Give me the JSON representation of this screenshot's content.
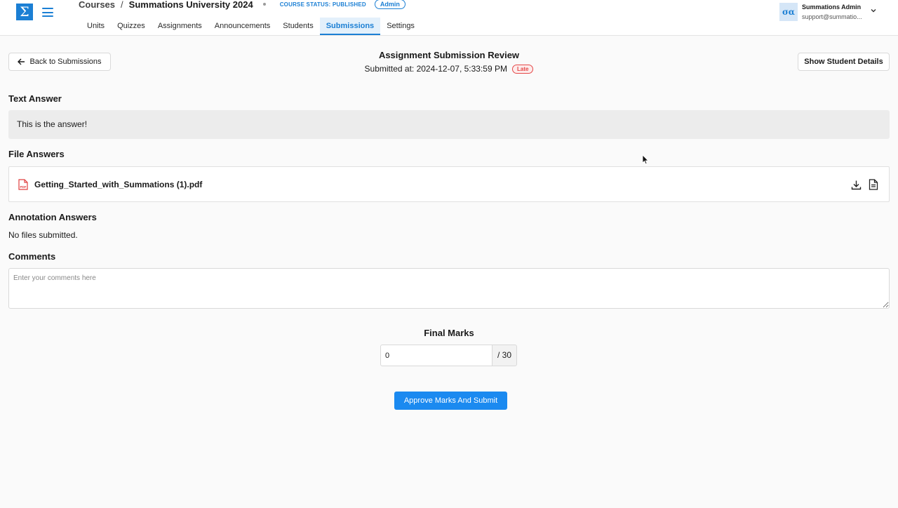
{
  "header": {
    "logo_glyph": "Σ",
    "breadcrumb": {
      "courses": "Courses",
      "separator": "/",
      "course_name": "Summations University 2024",
      "status": "COURSE STATUS: PUBLISHED",
      "role_badge": "Admin"
    },
    "tabs": [
      {
        "label": "Units",
        "active": false
      },
      {
        "label": "Quizzes",
        "active": false
      },
      {
        "label": "Assignments",
        "active": false
      },
      {
        "label": "Announcements",
        "active": false
      },
      {
        "label": "Students",
        "active": false
      },
      {
        "label": "Submissions",
        "active": true
      },
      {
        "label": "Settings",
        "active": false
      }
    ],
    "user": {
      "avatar_text": "σα",
      "name": "Summations Admin",
      "email": "support@summatio..."
    }
  },
  "review": {
    "back_label": "Back to Submissions",
    "title": "Assignment Submission Review",
    "submitted_at": "Submitted at: 2024-12-07, 5:33:59 PM",
    "late_badge": "Late",
    "show_details_label": "Show Student Details"
  },
  "text_answer": {
    "heading": "Text Answer",
    "content": "This is the answer!"
  },
  "file_answers": {
    "heading": "File Answers",
    "files": [
      {
        "name": "Getting_Started_with_Summations (1).pdf",
        "icon": "pdf-icon"
      }
    ]
  },
  "annotation_answers": {
    "heading": "Annotation Answers",
    "empty_text": "No files submitted."
  },
  "comments": {
    "heading": "Comments",
    "placeholder": "Enter your comments here",
    "value": ""
  },
  "marks": {
    "label": "Final Marks",
    "value": "0",
    "total": "/ 30"
  },
  "submit_label": "Approve Marks And Submit",
  "colors": {
    "accent": "#1b7fd4",
    "button": "#1b8af0",
    "late": "#e54848"
  }
}
